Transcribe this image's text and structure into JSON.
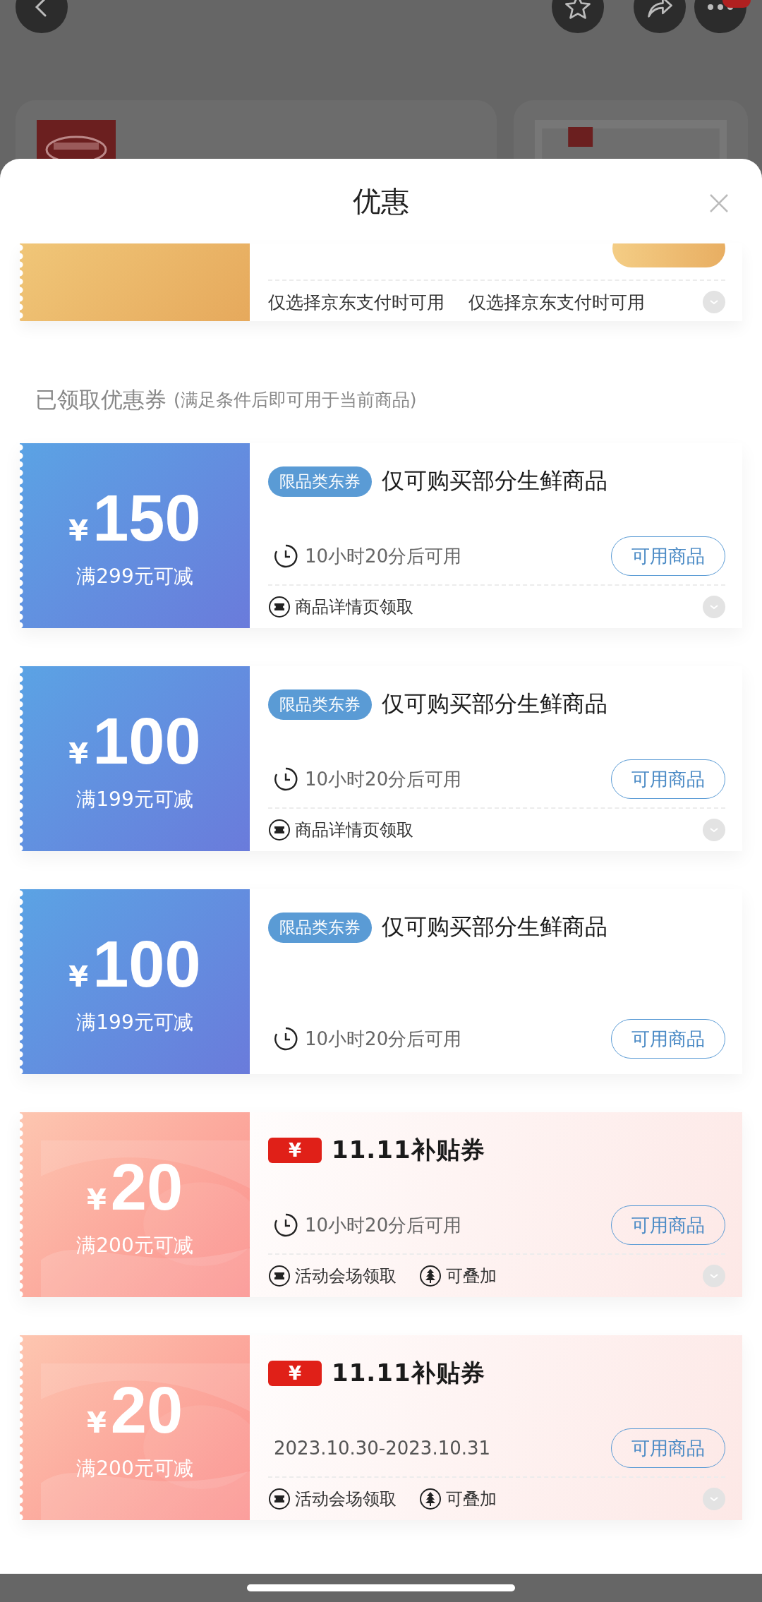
{
  "header": {
    "title": "优惠"
  },
  "top_coupon": {
    "kind": "gold",
    "usage_notes": [
      "仅选择京东支付时可用",
      "仅选择京东支付时可用"
    ],
    "expandable": true
  },
  "section": {
    "title": "已领取优惠券",
    "note": "(满足条件后即可用于当前商品)"
  },
  "coupons": [
    {
      "kind": "jd",
      "currency": "¥",
      "amount": "150",
      "condition": "满299元可减",
      "tag": "限品类东券",
      "title": "仅可购买部分生鲜商品",
      "timing": "10小时20分后可用",
      "clock_icon": true,
      "button": "可用商品",
      "source": "商品详情页领取",
      "expandable": true
    },
    {
      "kind": "jd",
      "currency": "¥",
      "amount": "100",
      "condition": "满199元可减",
      "tag": "限品类东券",
      "title": "仅可购买部分生鲜商品",
      "timing": "10小时20分后可用",
      "clock_icon": true,
      "button": "可用商品",
      "source": "商品详情页领取",
      "expandable": true
    },
    {
      "kind": "jd",
      "currency": "¥",
      "amount": "100",
      "condition": "满199元可减",
      "tag": "限品类东券",
      "title": "仅可购买部分生鲜商品",
      "timing": "10小时20分后可用",
      "clock_icon": true,
      "button": "可用商品",
      "expandable": false
    },
    {
      "kind": "subsidy",
      "currency": "¥",
      "amount": "20",
      "condition": "满200元可减",
      "logo_mark": "¥",
      "title": "11.11补贴券",
      "timing": "10小时20分后可用",
      "clock_icon": true,
      "button": "可用商品",
      "source": "活动会场领取",
      "stack": "可叠加",
      "expandable": true
    },
    {
      "kind": "subsidy",
      "currency": "¥",
      "amount": "20",
      "condition": "满200元可减",
      "logo_mark": "¥",
      "title": "11.11补贴券",
      "timing": "2023.10.30-2023.10.31",
      "clock_icon": false,
      "button": "可用商品",
      "source": "活动会场领取",
      "stack": "可叠加",
      "expandable": true
    }
  ]
}
